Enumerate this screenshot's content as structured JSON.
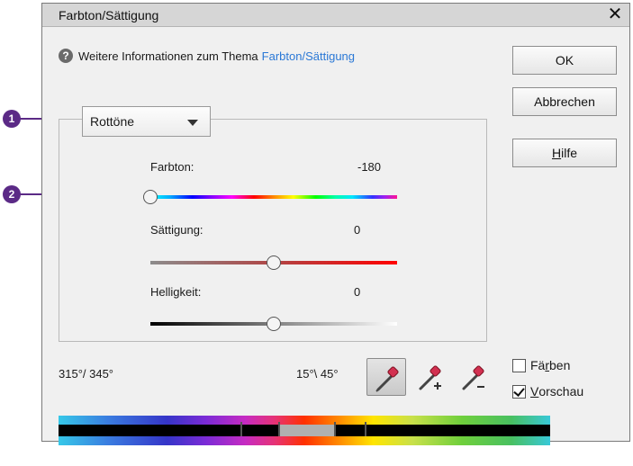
{
  "dialog": {
    "title": "Farbton/Sättigung",
    "close_glyph": "✕",
    "info_text": "Weitere Informationen zum Thema",
    "info_link": "Farbton/Sättigung"
  },
  "buttons": {
    "ok": "OK",
    "cancel": "Abbrechen",
    "help_mnemonic": "H",
    "help_rest": "ilfe"
  },
  "channel_select": {
    "selected": "Rottöne"
  },
  "sliders": {
    "hue": {
      "label": "Farbton:",
      "value": "-180",
      "min": -180,
      "max": 180
    },
    "saturation": {
      "label": "Sättigung:",
      "value": "0",
      "min": -100,
      "max": 100
    },
    "lightness": {
      "label": "Helligkeit:",
      "value": "0",
      "min": -100,
      "max": 100
    }
  },
  "ranges": {
    "left": "315°/ 345°",
    "right": "15°\\ 45°"
  },
  "eyedroppers": [
    {
      "icon": "eyedropper-icon",
      "active": true
    },
    {
      "icon": "eyedropper-add-icon",
      "active": false
    },
    {
      "icon": "eyedropper-subtract-icon",
      "active": false
    }
  ],
  "checkboxes": {
    "colorize": {
      "mnemonic_pre": "Fä",
      "mnemonic": "r",
      "post": "ben",
      "checked": false
    },
    "preview": {
      "mnemonic_pre": "",
      "mnemonic": "V",
      "post": "orschau",
      "checked": true
    }
  },
  "callouts": {
    "one": "1",
    "two": "2"
  },
  "colors": {
    "callout": "#5b2a86",
    "link": "#2a78d6",
    "titlebar": "#d6d6d6"
  }
}
